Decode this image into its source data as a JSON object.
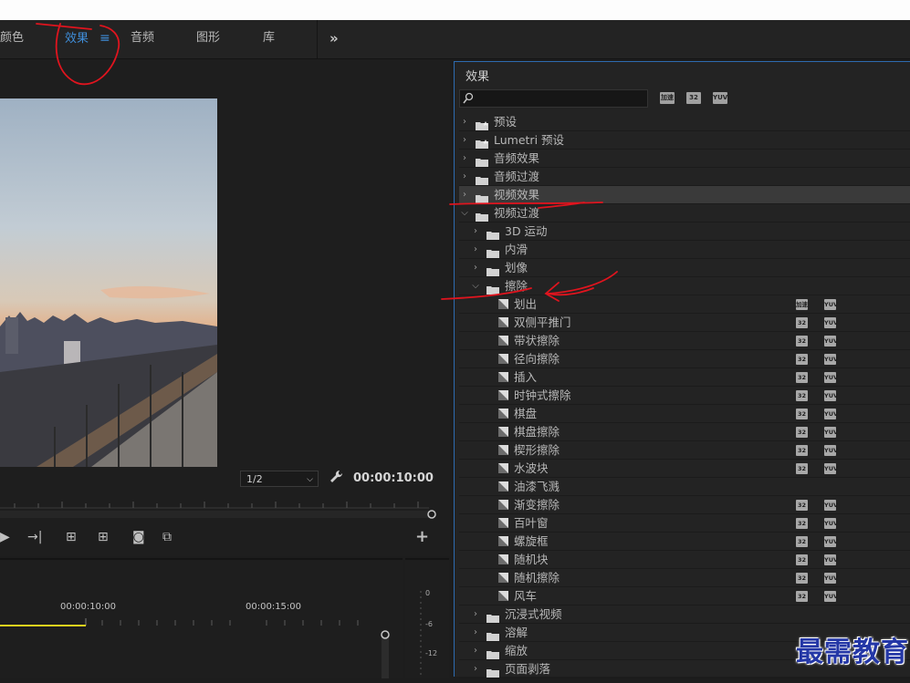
{
  "tabs": [
    {
      "label": "颜色",
      "active": false
    },
    {
      "label": "效果",
      "active": true,
      "menu_icon": "≡"
    },
    {
      "label": "音频",
      "active": false
    },
    {
      "label": "图形",
      "active": false
    },
    {
      "label": "库",
      "active": false
    }
  ],
  "tabs_overflow": "»",
  "monitor": {
    "zoom_value": "1/2",
    "timecode": "00:00:10:00"
  },
  "timeline": {
    "time_labels": [
      "00:00:10:00",
      "00:00:15:00"
    ],
    "meter_labels": [
      "0",
      "-6",
      "-12"
    ]
  },
  "effects_panel": {
    "title": "效果",
    "search_value": "",
    "filter_badges": [
      "加速",
      "32",
      "YUV"
    ]
  },
  "effects_tree": [
    {
      "label": "预设",
      "level": 0,
      "expanded": false,
      "kind": "preset-folder"
    },
    {
      "label": "Lumetri 预设",
      "level": 0,
      "expanded": false,
      "kind": "preset-folder"
    },
    {
      "label": "音频效果",
      "level": 0,
      "expanded": false,
      "kind": "folder"
    },
    {
      "label": "音频过渡",
      "level": 0,
      "expanded": false,
      "kind": "folder"
    },
    {
      "label": "视频效果",
      "level": 0,
      "expanded": false,
      "kind": "folder",
      "selected": true
    },
    {
      "label": "视频过渡",
      "level": 0,
      "expanded": true,
      "kind": "folder"
    },
    {
      "label": "3D 运动",
      "level": 1,
      "expanded": false,
      "kind": "folder"
    },
    {
      "label": "内滑",
      "level": 1,
      "expanded": false,
      "kind": "folder"
    },
    {
      "label": "划像",
      "level": 1,
      "expanded": false,
      "kind": "folder"
    },
    {
      "label": "擦除",
      "level": 1,
      "expanded": true,
      "kind": "folder"
    },
    {
      "label": "划出",
      "level": 2,
      "kind": "effect",
      "badges": [
        "accel",
        "yuv"
      ]
    },
    {
      "label": "双侧平推门",
      "level": 2,
      "kind": "effect",
      "badges": [
        "32",
        "yuv"
      ]
    },
    {
      "label": "带状擦除",
      "level": 2,
      "kind": "effect",
      "badges": [
        "32",
        "yuv"
      ]
    },
    {
      "label": "径向擦除",
      "level": 2,
      "kind": "effect",
      "badges": [
        "32",
        "yuv"
      ]
    },
    {
      "label": "插入",
      "level": 2,
      "kind": "effect",
      "badges": [
        "32",
        "yuv"
      ]
    },
    {
      "label": "时钟式擦除",
      "level": 2,
      "kind": "effect",
      "badges": [
        "32",
        "yuv"
      ]
    },
    {
      "label": "棋盘",
      "level": 2,
      "kind": "effect",
      "badges": [
        "32",
        "yuv"
      ]
    },
    {
      "label": "棋盘擦除",
      "level": 2,
      "kind": "effect",
      "badges": [
        "32",
        "yuv"
      ]
    },
    {
      "label": "楔形擦除",
      "level": 2,
      "kind": "effect",
      "badges": [
        "32",
        "yuv"
      ]
    },
    {
      "label": "水波块",
      "level": 2,
      "kind": "effect",
      "badges": [
        "32",
        "yuv"
      ]
    },
    {
      "label": "油漆飞溅",
      "level": 2,
      "kind": "effect",
      "badges": []
    },
    {
      "label": "渐变擦除",
      "level": 2,
      "kind": "effect",
      "badges": [
        "32",
        "yuv"
      ]
    },
    {
      "label": "百叶窗",
      "level": 2,
      "kind": "effect",
      "badges": [
        "32",
        "yuv"
      ]
    },
    {
      "label": "螺旋框",
      "level": 2,
      "kind": "effect",
      "badges": [
        "32",
        "yuv"
      ]
    },
    {
      "label": "随机块",
      "level": 2,
      "kind": "effect",
      "badges": [
        "32",
        "yuv"
      ]
    },
    {
      "label": "随机擦除",
      "level": 2,
      "kind": "effect",
      "badges": [
        "32",
        "yuv"
      ]
    },
    {
      "label": "风车",
      "level": 2,
      "kind": "effect",
      "badges": [
        "32",
        "yuv"
      ]
    },
    {
      "label": "沉浸式视频",
      "level": 1,
      "expanded": false,
      "kind": "folder"
    },
    {
      "label": "溶解",
      "level": 1,
      "expanded": false,
      "kind": "folder"
    },
    {
      "label": "缩放",
      "level": 1,
      "expanded": false,
      "kind": "folder"
    },
    {
      "label": "页面剥落",
      "level": 1,
      "expanded": false,
      "kind": "folder"
    }
  ],
  "badge_text": {
    "accel": "加速",
    "32": "32",
    "yuv": "YUV"
  },
  "watermark": "最需教育",
  "colors": {
    "accent": "#3f8dd8",
    "annotation": "#e0141e",
    "panel_border": "#2d6bb0"
  }
}
